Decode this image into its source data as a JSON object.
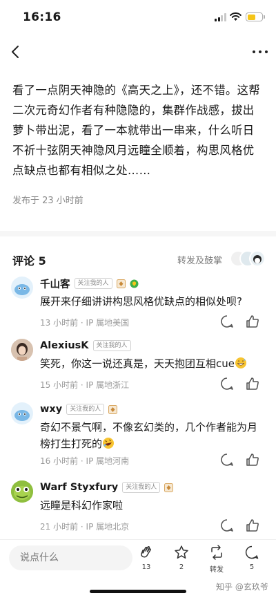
{
  "status_bar": {
    "time": "16:16",
    "battery_level": 0.55,
    "battery_color": "#f5c518"
  },
  "nav": {
    "back_icon": "chevron-left-icon",
    "more_icon": "more-horizontal-icon"
  },
  "article": {
    "body": "看了一点阴天神隐的《高天之上》，还不错。这帮二次元奇幻作者有种隐隐的，集群作战感，拔出萝卜带出泥，看了一本就带出一串来，什么听日不祈十弦阴天神隐风月远瞳全顺着，构思风格优点缺点也都有相似之处……",
    "publish_time": "发布于 23 小时前"
  },
  "comments_section": {
    "title": "评论 5",
    "repost_label": "转发及鼓掌"
  },
  "comments": [
    {
      "user": "千山客",
      "follow_tag": "关注我的人",
      "text": "展开来仔细讲讲构思风格优缺点的相似处呗?",
      "meta": "13 小时前 · IP 属地美国"
    },
    {
      "user": "AlexiusK",
      "follow_tag": "关注我的人",
      "text": "笑死，你这一说还真是，天天抱团互相cue",
      "meta": "15 小时前 · IP 属地浙江"
    },
    {
      "user": "wxy",
      "follow_tag": "关注我的人",
      "text": "奇幻不景气啊，不像玄幻类的，几个作者能为月榜打生打死的",
      "meta": "16 小时前 · IP 属地河南"
    },
    {
      "user": "Warf Styxfury",
      "follow_tag": "关注我的人",
      "text": "远瞳是科幻作家啦",
      "meta": "21 小时前 · IP 属地北京"
    }
  ],
  "bottom_bar": {
    "input_placeholder": "说点什么",
    "clap_count": "13",
    "star_count": "2",
    "repost_label": "转发",
    "comment_count": "5"
  },
  "watermark": "知乎 @玄玖爷"
}
